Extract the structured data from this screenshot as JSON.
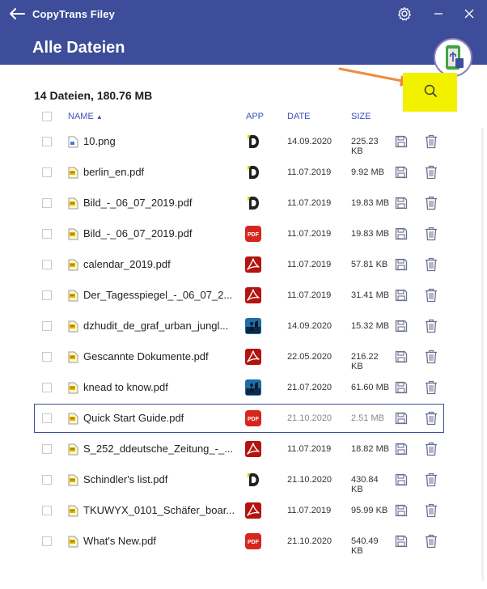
{
  "app_title": "CopyTrans Filey",
  "page_title": "Alle Dateien",
  "summary": "14 Dateien, 180.76 MB",
  "columns": {
    "name": "NAME",
    "app": "APP",
    "date": "DATE",
    "size": "SIZE"
  },
  "colors": {
    "accent": "#3d4d99",
    "highlight": "#f2f200",
    "arrow": "#f28a3c"
  },
  "files": [
    {
      "name": "10.png",
      "type": "image",
      "app": "documents-d",
      "date": "14.09.2020",
      "size": "225.23 KB"
    },
    {
      "name": "berlin_en.pdf",
      "type": "pdf",
      "app": "documents-d",
      "date": "11.07.2019",
      "size": "9.92 MB"
    },
    {
      "name": "Bild_-_06_07_2019.pdf",
      "type": "pdf",
      "app": "documents-d",
      "date": "11.07.2019",
      "size": "19.83 MB"
    },
    {
      "name": "Bild_-_06_07_2019.pdf",
      "type": "pdf",
      "app": "pdf-expert",
      "date": "11.07.2019",
      "size": "19.83 MB"
    },
    {
      "name": "calendar_2019.pdf",
      "type": "pdf",
      "app": "acrobat",
      "date": "11.07.2019",
      "size": "57.81 KB"
    },
    {
      "name": "Der_Tagesspiegel_-_06_07_2...",
      "type": "pdf",
      "app": "acrobat",
      "date": "11.07.2019",
      "size": "31.41 MB"
    },
    {
      "name": "dzhudit_de_graf_urban_jungl...",
      "type": "pdf",
      "app": "kindle",
      "date": "14.09.2020",
      "size": "15.32 MB"
    },
    {
      "name": "Gescannte Dokumente.pdf",
      "type": "pdf",
      "app": "acrobat",
      "date": "22.05.2020",
      "size": "216.22 KB"
    },
    {
      "name": "knead to know.pdf",
      "type": "pdf",
      "app": "kindle",
      "date": "21.07.2020",
      "size": "61.60 MB"
    },
    {
      "name": "Quick Start Guide.pdf",
      "type": "pdf",
      "app": "pdf-expert",
      "date": "21.10.2020",
      "size": "2.51 MB",
      "selected": true
    },
    {
      "name": "S_252_ddeutsche_Zeitung_-_...",
      "type": "pdf",
      "app": "acrobat",
      "date": "11.07.2019",
      "size": "18.82 MB"
    },
    {
      "name": "Schindler's list.pdf",
      "type": "pdf",
      "app": "documents-d",
      "date": "21.10.2020",
      "size": "430.84 KB"
    },
    {
      "name": "TKUWYX_0101_Schäfer_boar...",
      "type": "pdf",
      "app": "acrobat",
      "date": "11.07.2019",
      "size": "95.99 KB"
    },
    {
      "name": "What's New.pdf",
      "type": "pdf",
      "app": "pdf-expert",
      "date": "21.10.2020",
      "size": "540.49 KB"
    }
  ]
}
